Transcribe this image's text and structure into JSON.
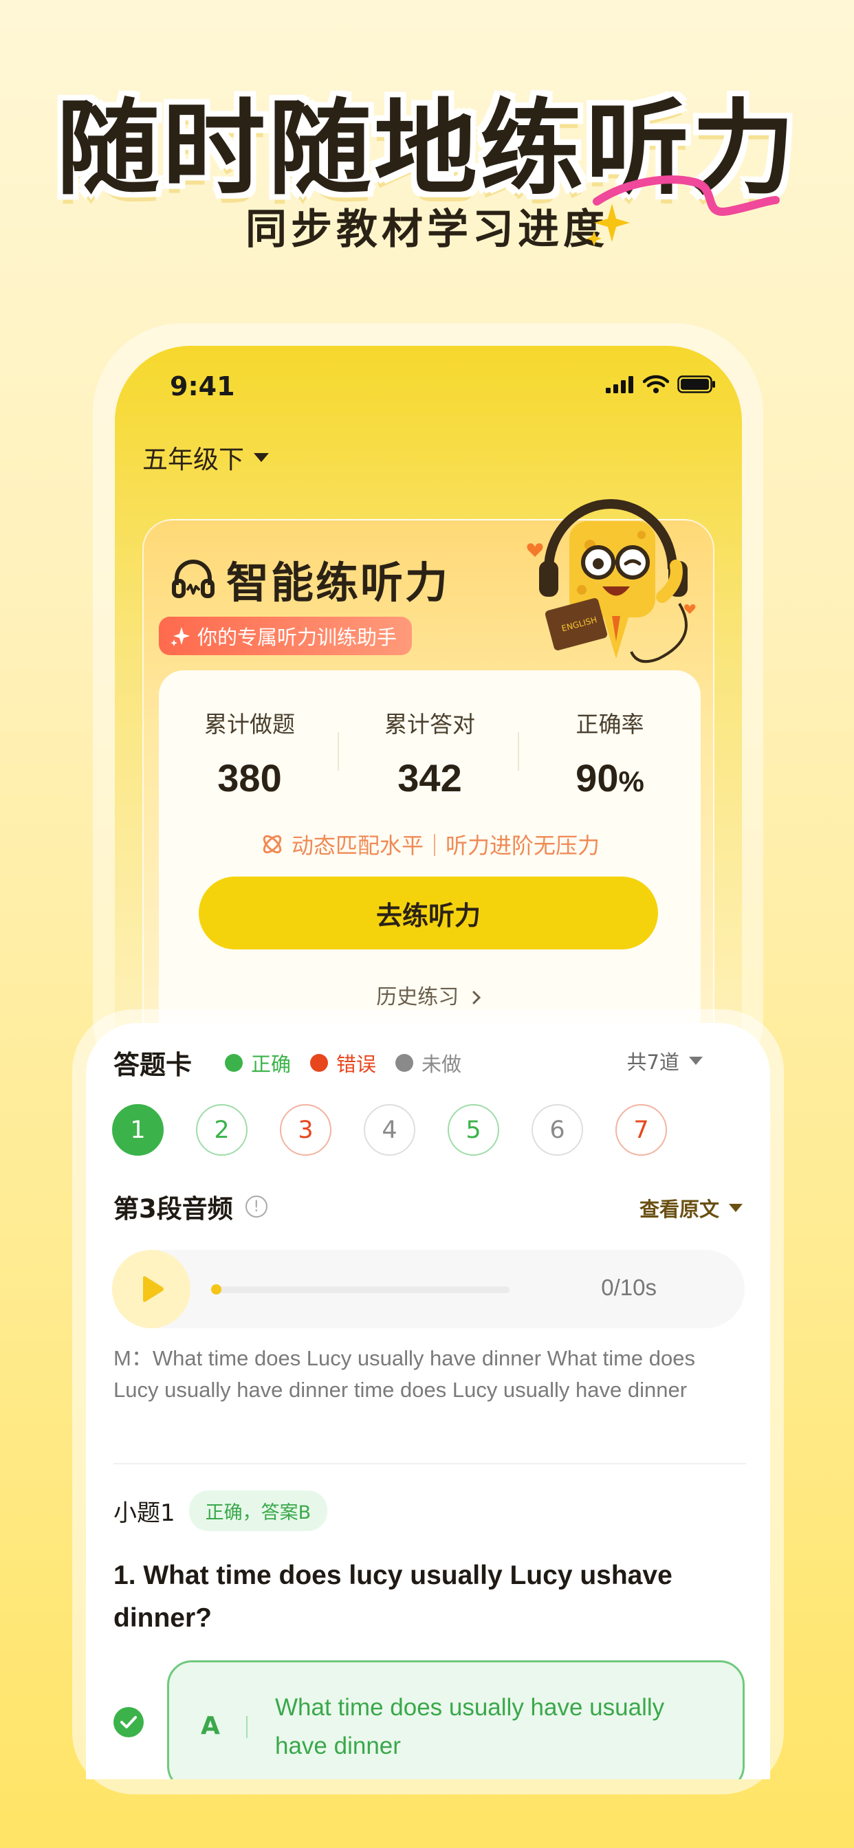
{
  "hero": {
    "title": "随时随地练听力",
    "subtitle": "同步教材学习进度"
  },
  "status_bar": {
    "time": "9:41"
  },
  "grade_selector": {
    "label": "五年级下"
  },
  "practice_card": {
    "title": "智能练听力",
    "badge": "你的专属听力训练助手",
    "stats": [
      {
        "label": "累计做题",
        "value": "380"
      },
      {
        "label": "累计答对",
        "value": "342"
      },
      {
        "label": "正确率",
        "value": "90",
        "unit": "%"
      }
    ],
    "tagline": "动态匹配水平｜听力进阶无压力",
    "cta_label": "去练听力",
    "history_label": "历史练习"
  },
  "answer_sheet": {
    "title": "答题卡",
    "legend": [
      {
        "label": "正确",
        "color": "#3bb34a"
      },
      {
        "label": "错误",
        "color": "#e8461d"
      },
      {
        "label": "未做",
        "color": "#8a8a8a"
      }
    ],
    "total_label": "共7道",
    "questions": [
      {
        "num": "1",
        "state": "current"
      },
      {
        "num": "2",
        "state": "correct"
      },
      {
        "num": "3",
        "state": "wrong"
      },
      {
        "num": "4",
        "state": "undone"
      },
      {
        "num": "5",
        "state": "correct"
      },
      {
        "num": "6",
        "state": "undone"
      },
      {
        "num": "7",
        "state": "wrong"
      }
    ]
  },
  "audio_section": {
    "title": "第3段音频",
    "view_original_label": "查看原文",
    "player": {
      "time_label": "0/10s",
      "progress": 0.0
    },
    "transcript": "M：What time does Lucy usually have dinner What time does Lucy usually have dinner time does Lucy usually have dinner"
  },
  "sub_question": {
    "label": "小题1",
    "result_tag": "正确，答案B",
    "question_text": "1. What time does lucy usually Lucy ushave dinner?",
    "options": [
      {
        "letter": "A",
        "text": "What time does usually have usually have dinner",
        "selected": true
      }
    ]
  },
  "colors": {
    "accent_yellow": "#f5d30c",
    "correct_green": "#3bb34a",
    "wrong_red": "#e8461d",
    "undone_gray": "#8a8a8a"
  }
}
